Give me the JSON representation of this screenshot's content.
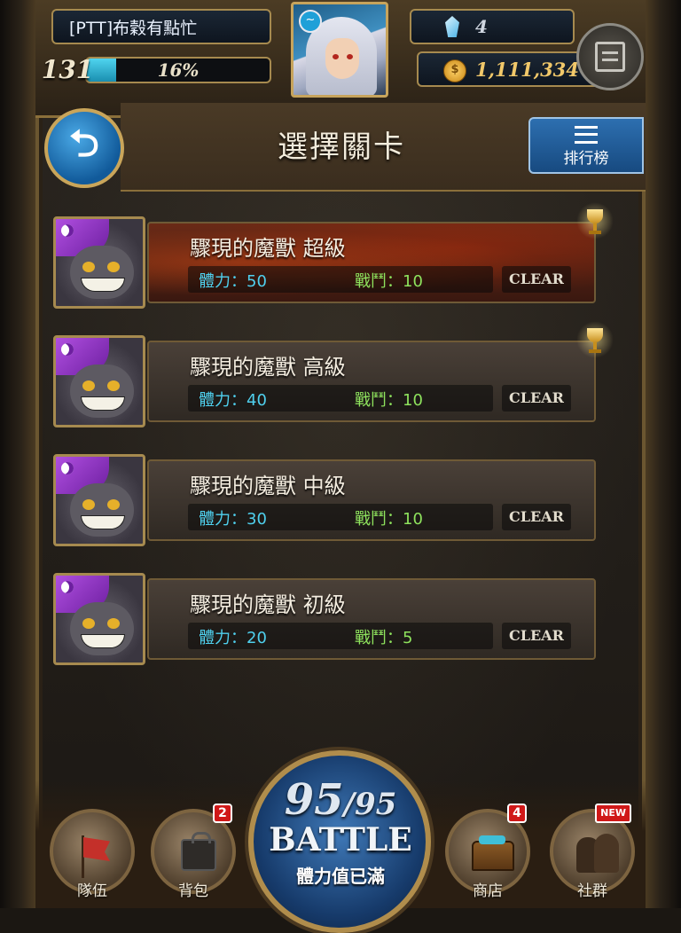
{
  "player": {
    "name": "[PTT]布穀有點忙",
    "level": "131",
    "exp_percent": 16,
    "exp_label": "16%",
    "gems": "4",
    "coins": "1,111,334"
  },
  "header": {
    "title": "選擇關卡",
    "ranking_label": "排行榜"
  },
  "stages": [
    {
      "title": "驟現的魔獸 超級",
      "stamina": "體力：50",
      "battles": "戰鬥：10",
      "status": "CLEAR",
      "trophy": true
    },
    {
      "title": "驟現的魔獸 高級",
      "stamina": "體力：40",
      "battles": "戰鬥：10",
      "status": "CLEAR",
      "trophy": true
    },
    {
      "title": "驟現的魔獸 中級",
      "stamina": "體力：30",
      "battles": "戰鬥：10",
      "status": "CLEAR",
      "trophy": false
    },
    {
      "title": "驟現的魔獸 初級",
      "stamina": "體力：20",
      "battles": "戰鬥：5",
      "status": "CLEAR",
      "trophy": false
    }
  ],
  "bottom_nav": {
    "team": {
      "label": "隊伍"
    },
    "bag": {
      "label": "背包",
      "badge": "2"
    },
    "shop": {
      "label": "商店",
      "badge": "4"
    },
    "social": {
      "label": "社群",
      "badge": "NEW"
    }
  },
  "battle": {
    "current": "95",
    "max": "/95",
    "label": "BATTLE",
    "status": "體力值已滿"
  }
}
